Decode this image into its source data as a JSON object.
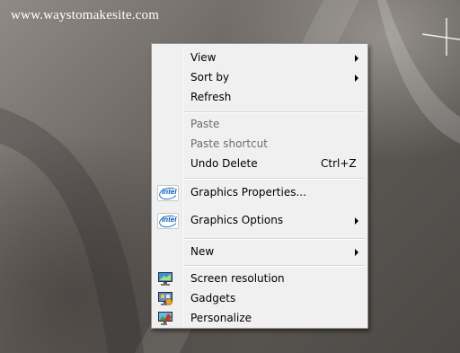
{
  "desktop": {
    "watermark": "www.waystomakesite.com"
  },
  "menu": {
    "items": [
      {
        "label": "View"
      },
      {
        "label": "Sort by"
      },
      {
        "label": "Refresh"
      },
      {
        "label": "Paste"
      },
      {
        "label": "Paste shortcut"
      },
      {
        "label": "Undo Delete",
        "shortcut": "Ctrl+Z"
      },
      {
        "label": "Graphics Properties...",
        "icon": "intel-icon"
      },
      {
        "label": "Graphics Options",
        "icon": "intel-icon"
      },
      {
        "label": "New"
      },
      {
        "label": "Screen resolution",
        "icon": "screen-resolution-icon"
      },
      {
        "label": "Gadgets",
        "icon": "gadgets-icon"
      },
      {
        "label": "Personalize",
        "icon": "personalize-icon"
      }
    ],
    "intel_icon_text": "intel"
  },
  "colors": {
    "menu_background": "#f0f0f0",
    "disabled_text": "#6d6d6d",
    "intel_blue": "#1e6fc0"
  }
}
